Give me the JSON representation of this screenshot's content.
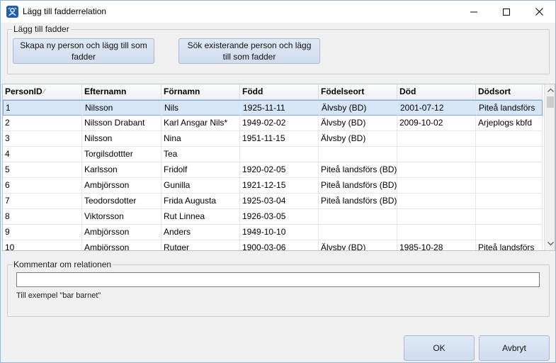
{
  "window": {
    "title": "Lägg till fadderrelation",
    "controls": [
      "minimize",
      "maximize",
      "close"
    ]
  },
  "add_group": {
    "legend": "Lägg till fadder",
    "new_person_button": "Skapa ny person och lägg till som fadder",
    "existing_person_button": "Sök existerande person och lägg till som fadder"
  },
  "grid": {
    "columns": [
      "PersonID",
      "Efternamn",
      "Förnamn",
      "Född",
      "Födelseort",
      "Död",
      "Dödsort"
    ],
    "sort_column": "PersonID",
    "selected_row": 0,
    "rows": [
      [
        "1",
        "Nilsson",
        "Nils",
        "1925-11-11",
        "Älvsby (BD)",
        "2001-07-12",
        "Piteå landsförs"
      ],
      [
        "2",
        "Nilsson Drabant",
        "Karl Ansgar Nils*",
        "1949-02-02",
        "Älvsby (BD)",
        "2009-10-02",
        "Arjeplogs kbfd"
      ],
      [
        "3",
        "Nilsson",
        "Nina",
        "1951-11-15",
        "Älvsby (BD)",
        "",
        ""
      ],
      [
        "4",
        "Torgilsdottter",
        "Tea",
        "",
        "",
        "",
        ""
      ],
      [
        "5",
        "Karlsson",
        "Fridolf",
        "1920-02-05",
        "Piteå landsförs (BD)",
        "",
        ""
      ],
      [
        "6",
        "Ambjörsson",
        "Gunilla",
        "1921-12-15",
        "Piteå landsförs (BD)",
        "",
        ""
      ],
      [
        "7",
        "Teodorsdotter",
        "Frida Augusta",
        "1925-03-04",
        "Piteå landsförs (BD)",
        "",
        ""
      ],
      [
        "8",
        "Viktorsson",
        "Rut Linnea",
        "1926-03-05",
        "",
        "",
        ""
      ],
      [
        "9",
        "Ambjörsson",
        "Anders",
        "1949-10-10",
        "",
        "",
        ""
      ],
      [
        "10",
        "Ambjörsson",
        "Rutger",
        "1900-03-06",
        "Älvsby (BD)",
        "1985-10-28",
        "Piteå landsförs"
      ]
    ]
  },
  "comment_group": {
    "legend": "Kommentar om relationen",
    "value": "",
    "hint": "Till exempel \"bar barnet\""
  },
  "footer": {
    "ok_label": "OK",
    "cancel_label": "Avbryt"
  },
  "colors": {
    "selection": "#d6e6f9",
    "button": "#d8e4f3"
  }
}
